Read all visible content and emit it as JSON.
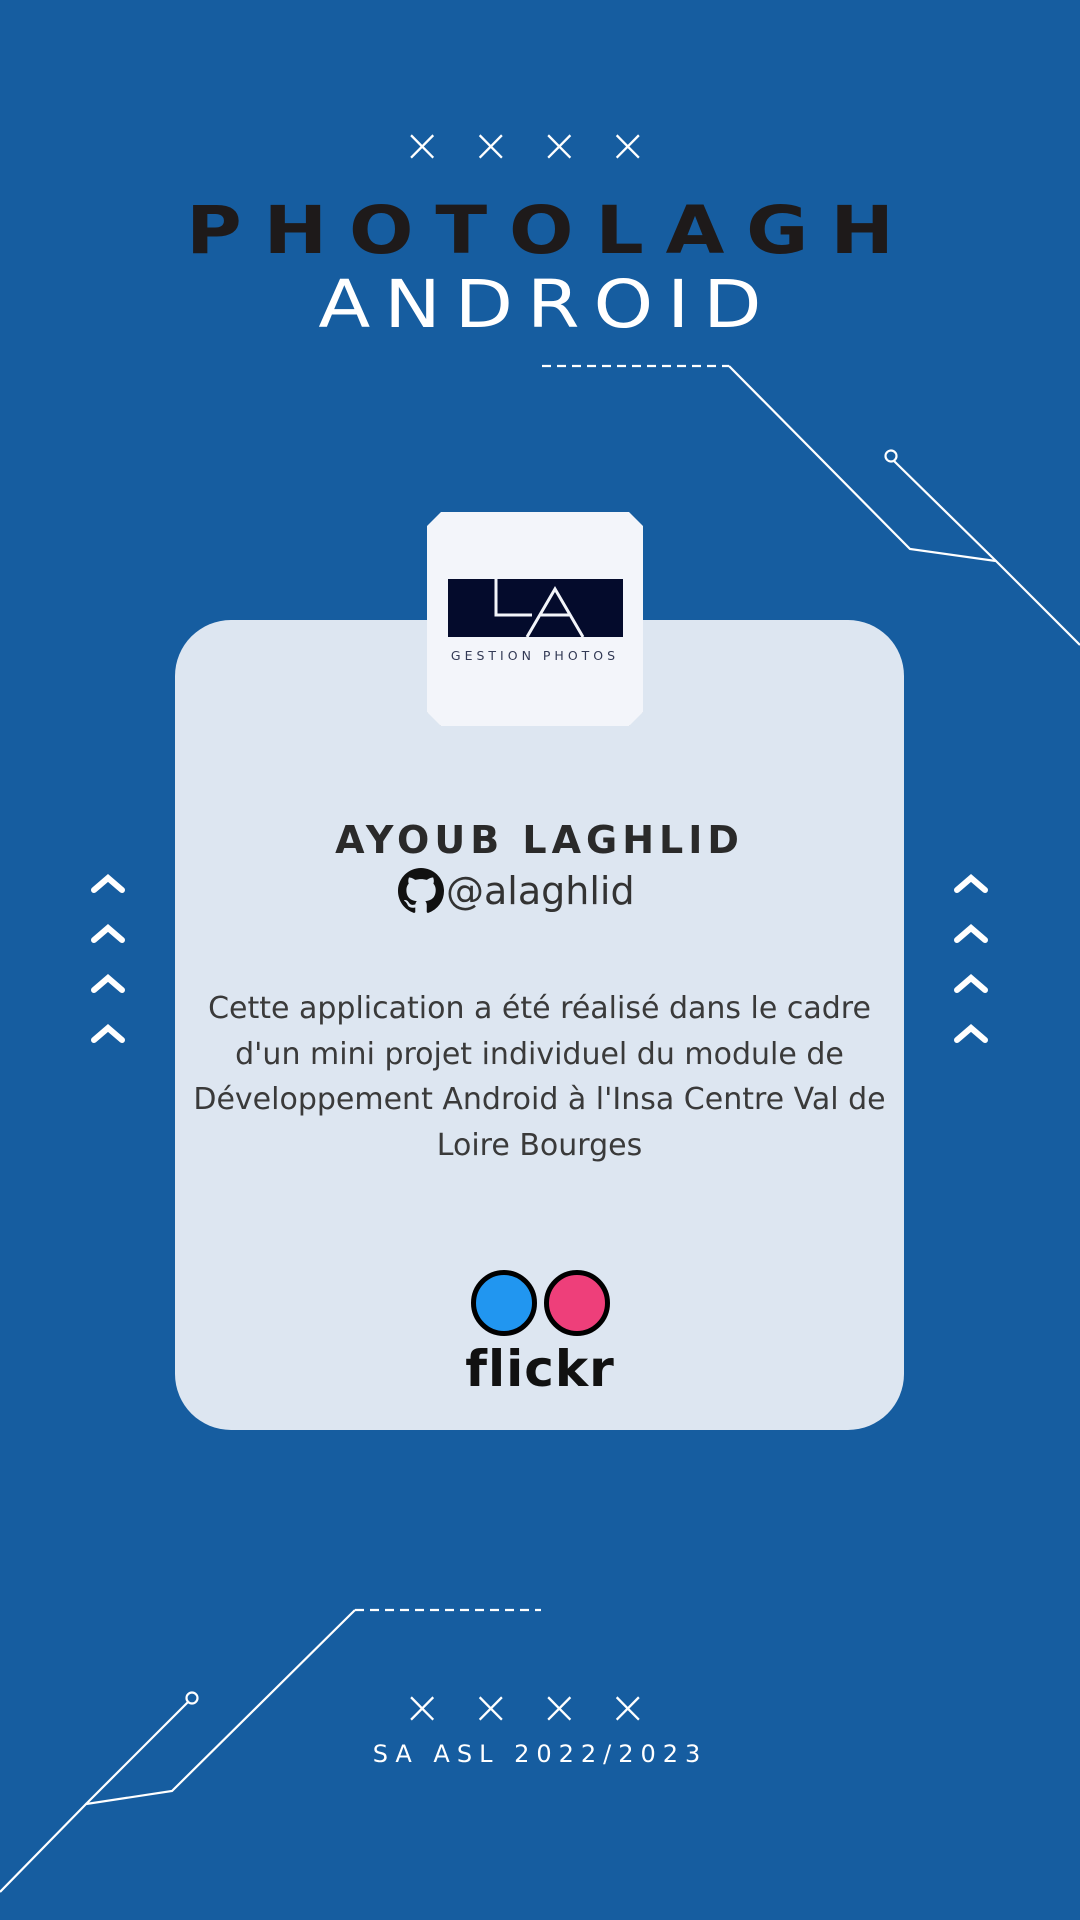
{
  "header": {
    "marks": "××××",
    "title_line1": "PHOTOLAGH",
    "title_line2": "ANDROID"
  },
  "logo": {
    "letters": "LA",
    "subtitle": "GESTION PHOTOS"
  },
  "profile": {
    "name": "AYOUB LAGHLID",
    "github_handle": "@alaghlid",
    "description": "Cette application a été réalisé dans le cadre d'un mini projet individuel du module de Développement Android à l'Insa Centre Val de Loire Bourges"
  },
  "flickr": {
    "label": "flickr",
    "colors": {
      "blue": "#2196f0",
      "pink": "#ee3f7a"
    }
  },
  "footer": {
    "marks": "××××",
    "text": "SA ASL 2022/2023"
  },
  "colors": {
    "background": "#165da0",
    "card": "#dde6f1",
    "title_dark": "#1e1a1a"
  }
}
